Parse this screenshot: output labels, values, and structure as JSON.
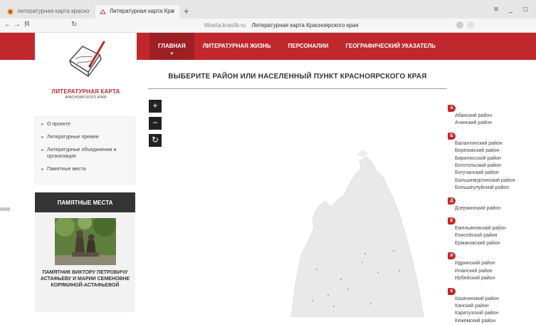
{
  "browser": {
    "tabs": [
      {
        "label": "литературная карта красно"
      },
      {
        "label": "Литературная карта Кра"
      }
    ],
    "new_tab": "+",
    "close_symbol": "×",
    "win_controls": "≡ _ □",
    "back": "←",
    "forward": "→",
    "home_letter": "Я",
    "reload": "↻",
    "url_domain": "litkarta.kraslib.ru",
    "url_title": "Литературная карта Красноярского края"
  },
  "header": {
    "menu": [
      {
        "label": "ГЛАВНАЯ"
      },
      {
        "label": "ЛИТЕРАТУРНАЯ ЖИЗНЬ"
      },
      {
        "label": "ПЕРСОНАЛИИ"
      },
      {
        "label": "ГЕОГРАФИЧЕСКИЙ УКАЗАТЕЛЬ"
      }
    ],
    "caret": "▼",
    "logo_title": "ЛИТЕРАТУРНАЯ КАРТА",
    "logo_sub": "КРАСНОЯРСКОГО КРАЯ",
    "brand_color": "#c0282d"
  },
  "main": {
    "heading": "ВЫБЕРИТЕ РАЙОН ИЛИ НАСЕЛЕННЫЙ ПУНКТ КРАСНОЯРСКОГО КРАЯ",
    "zoom_in": "+",
    "zoom_out": "−",
    "reset": "↻"
  },
  "sidebar": {
    "nav": [
      {
        "label": "О проекте"
      },
      {
        "label": "Литературные премии"
      },
      {
        "label": "Литературные объединения и организации"
      },
      {
        "label": "Памятные места"
      }
    ],
    "memorial": {
      "heading": "ПАМЯТНЫЕ МЕСТА",
      "caption": "ПАМЯТНИК ВИКТОРУ ПЕТРОВИЧУ АСТАФЬЕВУ И МАРИИ СЕМЕНОВНЕ КОРЯКИНОЙ-АСТАФЬЕВОЙ"
    }
  },
  "districts": {
    "groups": [
      {
        "letter": "А",
        "items": [
          "Абанский район",
          "Ачинский район"
        ]
      },
      {
        "letter": "Б",
        "items": [
          "Балахтинский район",
          "Березовский район",
          "Бирилюсский район",
          "Боготольский район",
          "Богучанский район",
          "Большемуртинский район",
          "Большеулуйский район"
        ]
      },
      {
        "letter": "Д",
        "items": [
          "Дзержинский район"
        ]
      },
      {
        "letter": "Е",
        "items": [
          "Емельяновский район",
          "Енисейский район",
          "Ермаковский район"
        ]
      },
      {
        "letter": "И",
        "items": [
          "Идринский район",
          "Иланский район",
          "Ирбейский район"
        ]
      },
      {
        "letter": "К",
        "items": [
          "Казачинский район",
          "Канский район",
          "Каратузский район",
          "Кежемский район"
        ]
      }
    ]
  }
}
